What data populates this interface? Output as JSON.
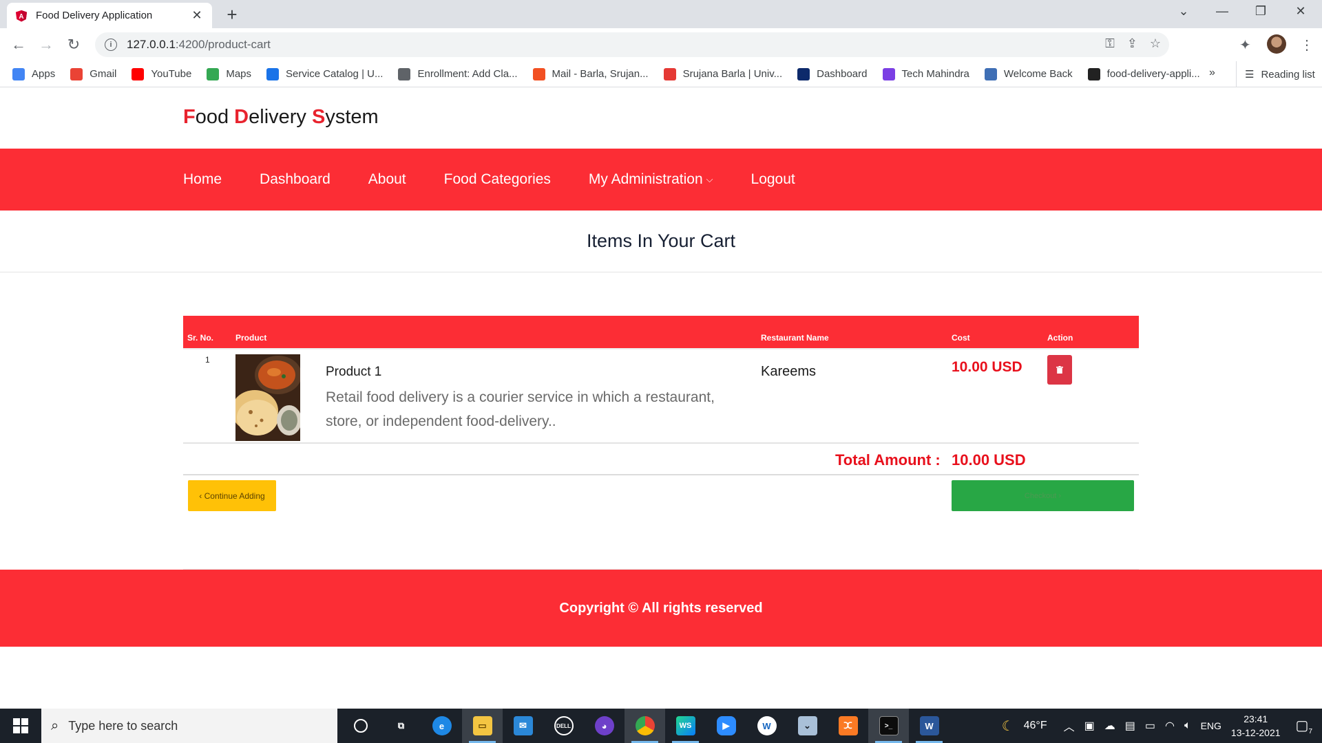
{
  "browser": {
    "tab_title": "Food Delivery Application",
    "url_host": "127.0.0.1",
    "url_path": ":4200/product-cart",
    "bookmarks": [
      {
        "label": "Apps",
        "icon": "apps-grid-icon",
        "color": "#4285f4"
      },
      {
        "label": "Gmail",
        "icon": "gmail-icon",
        "color": "#ea4335"
      },
      {
        "label": "YouTube",
        "icon": "youtube-icon",
        "color": "#ff0000"
      },
      {
        "label": "Maps",
        "icon": "maps-icon",
        "color": "#34a853"
      },
      {
        "label": "Service Catalog | U...",
        "icon": "service-catalog-icon",
        "color": "#1a73e8"
      },
      {
        "label": "Enrollment: Add Cla...",
        "icon": "document-icon",
        "color": "#5f6368"
      },
      {
        "label": "Mail - Barla, Srujan...",
        "icon": "microsoft-icon",
        "color": "#f25022"
      },
      {
        "label": "Srujana Barla | Univ...",
        "icon": "university-icon",
        "color": "#e53935"
      },
      {
        "label": "Dashboard",
        "icon": "m-logo-icon",
        "color": "#0d2a6b"
      },
      {
        "label": "Tech Mahindra",
        "icon": "tech-mahindra-icon",
        "color": "#7b3fe4"
      },
      {
        "label": "Welcome Back",
        "icon": "globe-icon",
        "color": "#3f6fb5"
      },
      {
        "label": "food-delivery-appli...",
        "icon": "github-icon",
        "color": "#222222"
      }
    ],
    "more_bookmarks": "»",
    "reading_list": "Reading list"
  },
  "site": {
    "brand": {
      "f": "F",
      "ood": "ood ",
      "d": "D",
      "elivery": "elivery ",
      "s": "S",
      "ystem": "ystem"
    },
    "nav": [
      "Home",
      "Dashboard",
      "About",
      "Food Categories",
      "My Administration",
      "Logout"
    ],
    "heading": "Items In Your Cart",
    "table_headers": {
      "sr": "Sr. No.",
      "product": "Product",
      "restaurant": "Restaurant Name",
      "cost": "Cost",
      "action": "Action"
    },
    "items": [
      {
        "sr": "1",
        "name": "Product 1",
        "description": "Retail food delivery is a courier service in which a restaurant, store, or independent food-delivery..",
        "restaurant": "Kareems",
        "cost": "10.00 USD"
      }
    ],
    "total_label": "Total Amount :",
    "total_value": "10.00 USD",
    "continue_label": "‹ Continue Adding",
    "checkout_label": "Checkout ›",
    "footer": "Copyright © All rights reserved",
    "colors": {
      "primary": "#fc2d35",
      "accent_text": "#e8101c",
      "continue": "#ffc107",
      "checkout": "#28a745",
      "delete": "#dc3545"
    }
  },
  "taskbar": {
    "search_placeholder": "Type here to search",
    "weather": "46°F",
    "language": "ENG",
    "time": "23:41",
    "date": "13-12-2021",
    "notifications": "7"
  }
}
